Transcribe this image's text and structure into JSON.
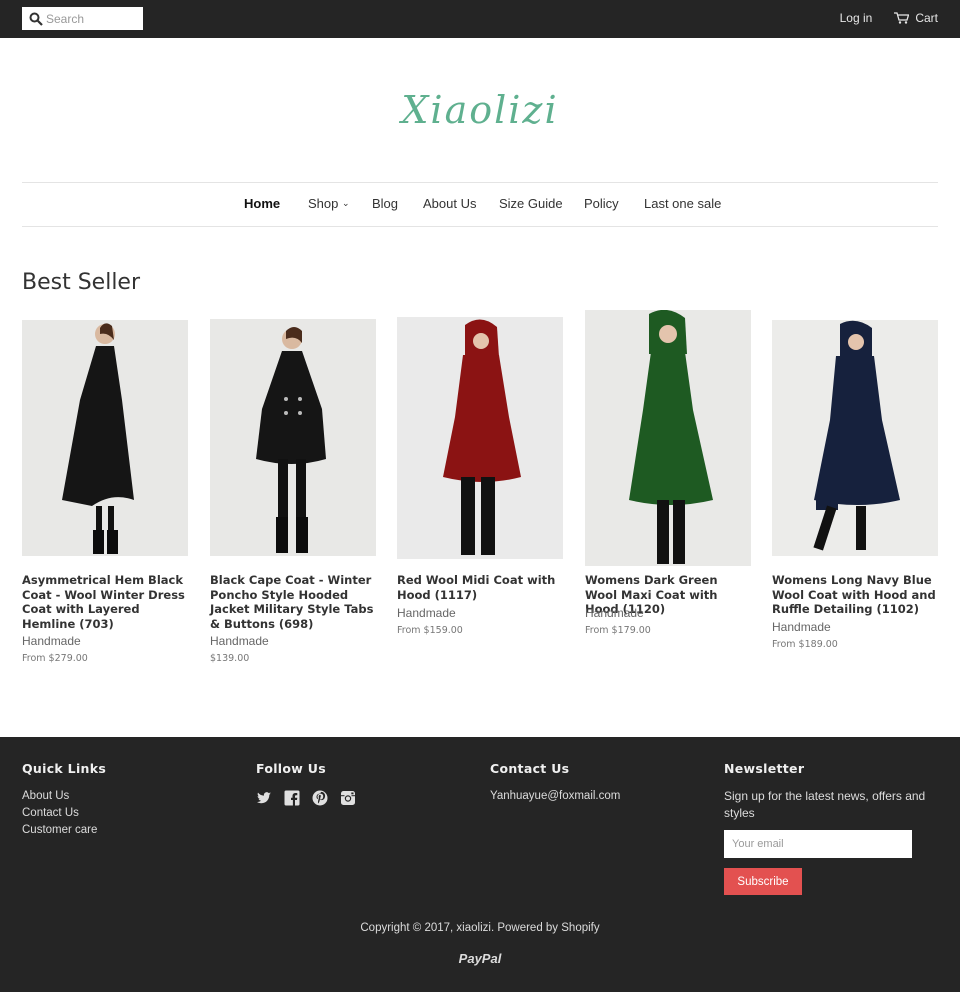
{
  "header": {
    "search_placeholder": "Search",
    "login_label": "Log in",
    "cart_label": "Cart"
  },
  "logo": {
    "text": "Xiaolizi"
  },
  "nav": {
    "items": [
      {
        "label": "Home"
      },
      {
        "label": "Shop"
      },
      {
        "label": "Blog"
      },
      {
        "label": "About Us"
      },
      {
        "label": "Size Guide"
      },
      {
        "label": "Policy"
      },
      {
        "label": "Last one sale"
      }
    ],
    "shop_caret": "⌄"
  },
  "section": {
    "title": "Best Seller"
  },
  "products": [
    {
      "title": "Asymmetrical Hem Black Coat - Wool Winter Dress Coat with Layered Hemline (703)",
      "vendor": "Handmade",
      "price": "From $279.00",
      "coat_color": "#151515"
    },
    {
      "title": "Black Cape Coat - Winter Poncho Style Hooded Jacket Military Style Tabs & Buttons (698)",
      "vendor": "Handmade",
      "price": "$139.00",
      "coat_color": "#151515"
    },
    {
      "title": "Red Wool Midi Coat with Hood (1117)",
      "vendor": "Handmade",
      "price": "From $159.00",
      "coat_color": "#8b1313"
    },
    {
      "title": "Womens Dark Green Wool Maxi Coat with Hood (1120)",
      "vendor": "Handmade",
      "price": "From $179.00",
      "coat_color": "#1e5a22"
    },
    {
      "title": "Womens Long Navy Blue Wool Coat with Hood and Ruffle Detailing (1102)",
      "vendor": "Handmade",
      "price": "From $189.00",
      "coat_color": "#16213d"
    }
  ],
  "footer": {
    "quick_links": {
      "heading": "Quick Links",
      "links": [
        "About Us",
        "Contact Us",
        "Customer care"
      ]
    },
    "follow": {
      "heading": "Follow Us",
      "icons": [
        "twitter-icon",
        "facebook-icon",
        "pinterest-icon",
        "instagram-icon"
      ]
    },
    "contact": {
      "heading": "Contact Us",
      "email": "Yanhuayue@foxmail.com"
    },
    "newsletter": {
      "heading": "Newsletter",
      "text": "Sign up for the latest news, offers and styles",
      "email_placeholder": "Your email",
      "button_label": "Subscribe",
      "button_color": "#e35150"
    },
    "copyright": "Copyright © 2017, xiaolizi. Powered by Shopify",
    "payment": "PayPal"
  },
  "colors": {
    "topbar": "#252525",
    "logo": "#5fb08f",
    "footer": "#252525"
  }
}
